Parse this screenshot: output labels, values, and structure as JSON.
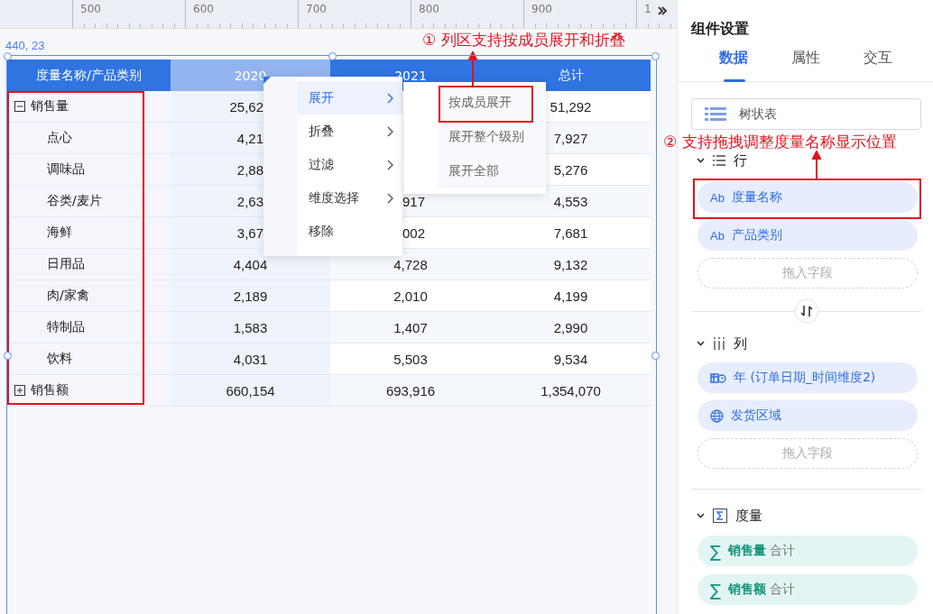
{
  "ruler": {
    "labels": [
      "500",
      "600",
      "700",
      "800",
      "900",
      "1"
    ]
  },
  "position_label": "440, 23",
  "table": {
    "columns": [
      {
        "label": "度量名称/产品类别",
        "selected": false
      },
      {
        "label": "2020",
        "selected": true
      },
      {
        "label": "2021",
        "selected": false
      },
      {
        "label": "总计",
        "selected": false
      }
    ],
    "rows": [
      {
        "expanded": true,
        "cells": [
          {
            "text": "销售量"
          },
          {
            "text": "25,62",
            "covered": true
          },
          null,
          {
            "text": "51,292"
          }
        ],
        "children": [
          {
            "cells": [
              {
                "text": "点心"
              },
              {
                "text": "4,21",
                "covered": true
              },
              null,
              {
                "text": "7,927"
              }
            ]
          },
          {
            "cells": [
              {
                "text": "调味品"
              },
              {
                "text": "2,88",
                "covered": true
              },
              null,
              {
                "text": "5,276"
              }
            ]
          },
          {
            "cells": [
              {
                "text": "谷类/麦片"
              },
              {
                "text": "2,63",
                "covered": true
              },
              {
                "text": "917",
                "covered": true
              },
              {
                "text": "4,553"
              }
            ]
          },
          {
            "cells": [
              {
                "text": "海鲜"
              },
              {
                "text": "3,67",
                "covered": true
              },
              {
                "text": "002",
                "covered": true
              },
              {
                "text": "7,681"
              }
            ]
          },
          {
            "cells": [
              {
                "text": "日用品"
              },
              {
                "text": "4,404"
              },
              {
                "text": "4,728"
              },
              {
                "text": "9,132"
              }
            ]
          },
          {
            "cells": [
              {
                "text": "肉/家禽"
              },
              {
                "text": "2,189"
              },
              {
                "text": "2,010"
              },
              {
                "text": "4,199"
              }
            ]
          },
          {
            "cells": [
              {
                "text": "特制品"
              },
              {
                "text": "1,583"
              },
              {
                "text": "1,407"
              },
              {
                "text": "2,990"
              }
            ]
          },
          {
            "cells": [
              {
                "text": "饮料"
              },
              {
                "text": "4,031"
              },
              {
                "text": "5,503"
              },
              {
                "text": "9,534"
              }
            ]
          }
        ]
      },
      {
        "expanded": false,
        "cells": [
          {
            "text": "销售额"
          },
          {
            "text": "660,154"
          },
          {
            "text": "693,916"
          },
          {
            "text": "1,354,070"
          }
        ]
      }
    ]
  },
  "context_menu": {
    "items": [
      {
        "label": "展开",
        "submenu": true,
        "selected": true
      },
      {
        "label": "折叠",
        "submenu": true,
        "selected": false
      },
      {
        "label": "过滤",
        "submenu": true,
        "selected": false
      },
      {
        "label": "维度选择",
        "submenu": true,
        "selected": false
      },
      {
        "label": "移除",
        "submenu": false,
        "selected": false
      }
    ],
    "submenu": [
      "按成员展开",
      "展开整个级别",
      "展开全部"
    ]
  },
  "annotations": [
    "① 列区支持按成员展开和折叠",
    "② 支持拖拽调整度量名称显示位置"
  ],
  "panel": {
    "title": "组件设置",
    "tabs": [
      {
        "label": "数据",
        "selected": true
      },
      {
        "label": "属性",
        "selected": false
      },
      {
        "label": "交互",
        "selected": false
      }
    ],
    "chart_type": "树状表",
    "sections": [
      {
        "kind": "rows",
        "title": "行",
        "expanded": true,
        "placeholder": "拖入字段",
        "fields": [
          {
            "kind": "text",
            "icon": "Ab",
            "label": "度量名称"
          },
          {
            "kind": "text",
            "icon": "Ab",
            "label": "产品类别"
          }
        ]
      },
      {
        "kind": "columns",
        "title": "列",
        "expanded": true,
        "placeholder": "拖入字段",
        "fields": [
          {
            "kind": "date",
            "label": "年 (订单日期_时间维度2)"
          },
          {
            "kind": "geo",
            "label": "发货区域"
          }
        ]
      },
      {
        "kind": "measures",
        "title": "度量",
        "expanded": true,
        "fields": [
          {
            "kind": "measure",
            "icon": "∑",
            "label": "销售量",
            "aggregation": "合计"
          },
          {
            "kind": "measure",
            "icon": "∑",
            "label": "销售额",
            "aggregation": "合计"
          }
        ]
      }
    ]
  }
}
